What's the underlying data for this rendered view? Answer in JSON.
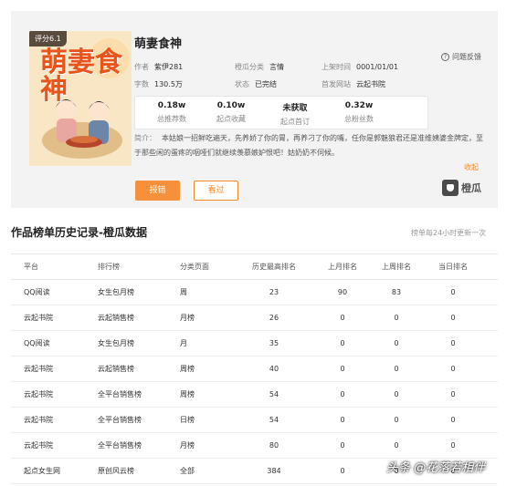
{
  "book": {
    "score": "评分6.1",
    "cover_title": "萌妻食神",
    "title": "萌妻食神",
    "feedback": "问题反馈",
    "meta": {
      "author_k": "作者",
      "author_v": "紫伊281",
      "category_k": "橙瓜分类",
      "category_v": "言情",
      "listed_k": "上架时间",
      "listed_v": "0001/01/01",
      "words_k": "字数",
      "words_v": "130.5万",
      "status_k": "状态",
      "status_v": "已完结",
      "site_k": "首发网站",
      "site_v": "云起书院"
    },
    "stats": [
      {
        "value": "0.18w",
        "label": "总推荐数"
      },
      {
        "value": "0.10w",
        "label": "起点收藏"
      },
      {
        "value": "未获取",
        "label": "起点首订"
      },
      {
        "value": "0.32w",
        "label": "总粉丝数"
      }
    ],
    "intro_label": "简介：",
    "intro_text": "本姑娘一招鲜吃遍天，先养娇了你的胃，再养刁了你的嘴，任你是郭魅狼君还是准维姨婆金牌定，至于那些闲的蛋疼的咽哑们就继续羡慕嫉妒恨吧！姑奶奶不伺候。",
    "collapse": "收起",
    "buttons": {
      "primary": "报错",
      "secondary": "看过"
    },
    "brand": "橙瓜"
  },
  "history": {
    "title": "作品榜单历史记录-橙瓜数据",
    "note": "榜单每24小时更新一次",
    "headers": [
      "平台",
      "排行榜",
      "分类页面",
      "历史最高排名",
      "上月排名",
      "上周排名",
      "当日排名"
    ],
    "rows": [
      [
        "QQ阅读",
        "女生包月榜",
        "周",
        "23",
        "90",
        "83",
        "0"
      ],
      [
        "云起书院",
        "云起销售榜",
        "月榜",
        "26",
        "0",
        "0",
        "0"
      ],
      [
        "QQ阅读",
        "女生包月榜",
        "月",
        "35",
        "0",
        "0",
        "0"
      ],
      [
        "云起书院",
        "云起销售榜",
        "周榜",
        "40",
        "0",
        "0",
        "0"
      ],
      [
        "云起书院",
        "全平台销售榜",
        "周榜",
        "54",
        "0",
        "0",
        "0"
      ],
      [
        "云起书院",
        "全平台销售榜",
        "日榜",
        "54",
        "0",
        "0",
        "0"
      ],
      [
        "云起书院",
        "全平台销售榜",
        "月榜",
        "80",
        "0",
        "0",
        "0"
      ],
      [
        "起点女生网",
        "原创风云榜",
        "全部",
        "384",
        "0",
        "0",
        "0"
      ]
    ]
  },
  "watermark": "头条 @花落若相伴"
}
